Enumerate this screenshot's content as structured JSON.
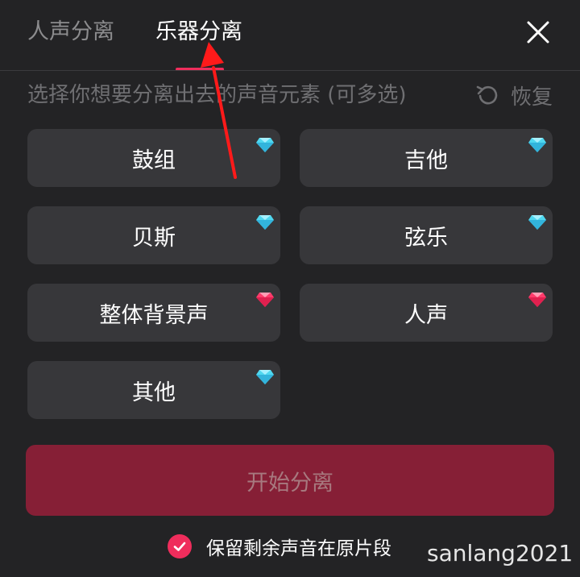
{
  "tabs": {
    "vocal_label": "人声分离",
    "instrument_label": "乐器分离",
    "active": "乐器分离"
  },
  "hint": "选择你想要分离出去的声音元素 (可多选)",
  "restore_label": "恢复",
  "options": [
    {
      "label": "鼓组",
      "gem": "blue-diamond-icon"
    },
    {
      "label": "吉他",
      "gem": "blue-diamond-icon"
    },
    {
      "label": "贝斯",
      "gem": "blue-diamond-icon"
    },
    {
      "label": "弦乐",
      "gem": "blue-diamond-icon"
    },
    {
      "label": "整体背景声",
      "gem": "pink-diamond-icon"
    },
    {
      "label": "人声",
      "gem": "pink-diamond-icon"
    },
    {
      "label": "其他",
      "gem": "blue-diamond-icon"
    }
  ],
  "start_label": "开始分离",
  "keep_label": "保留剩余声音在原片段",
  "keep_checked": true,
  "watermark": "sanlang2021",
  "colors": {
    "background": "#232325",
    "option_bg": "#37373a",
    "accent": "#ef2d5c",
    "start_bg": "#861f36",
    "blue_gem": "#4fd8f0",
    "pink_gem": "#ff3b6b",
    "annotation_arrow": "#ff1a1a"
  }
}
